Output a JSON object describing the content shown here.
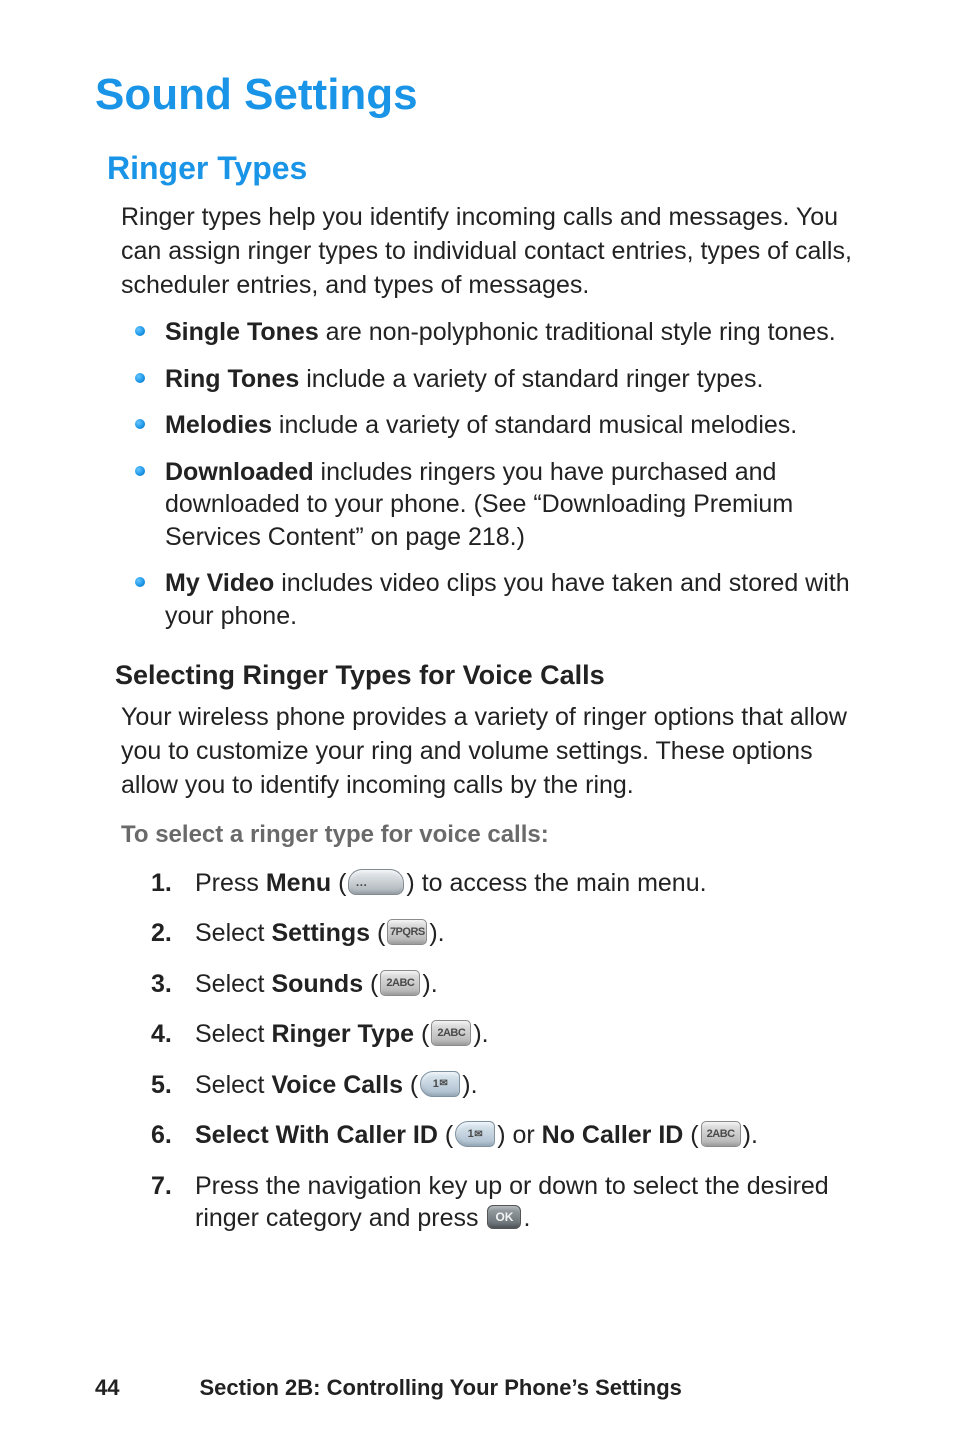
{
  "heading": "Sound Settings",
  "subheading": "Ringer Types",
  "intro": "Ringer types help you identify incoming calls and messages. You can assign ringer types to individual contact entries, types of calls, scheduler entries, and types of messages.",
  "bullets": [
    {
      "term": "Single Tones",
      "rest": " are non-polyphonic traditional style ring tones."
    },
    {
      "term": "Ring Tones",
      "rest": " include a variety of standard ringer types."
    },
    {
      "term": "Melodies",
      "rest": " include a variety of standard musical melodies."
    },
    {
      "term": "Downloaded",
      "rest": " includes ringers you have purchased and downloaded to your phone. (See “Downloading Premium Services Content” on page 218.)"
    },
    {
      "term": "My Video",
      "rest": " includes video clips you have taken and stored with your phone."
    }
  ],
  "subsection": "Selecting Ringer Types for Voice Calls",
  "subsection_para": "Your wireless phone provides a variety of ringer options that allow you to customize your ring and volume settings. These options allow you to identify incoming calls by the ring.",
  "instruction": "To select a ringer type for voice calls:",
  "steps": {
    "s1": {
      "prefix": "Press ",
      "bold": "Menu",
      "paren_open": " (",
      "paren_close": ") to access the main menu."
    },
    "s2": {
      "prefix": "Select ",
      "bold": "Settings",
      "paren_open": " (",
      "paren_close": ")."
    },
    "s3": {
      "prefix": "Select ",
      "bold": "Sounds",
      "paren_open": " (",
      "paren_close": ")."
    },
    "s4": {
      "prefix": "Select ",
      "bold": "Ringer Type",
      "paren_open": " (",
      "paren_close": ")."
    },
    "s5": {
      "prefix": "Select ",
      "bold": "Voice Calls",
      "paren_open": " (",
      "paren_close": ")."
    },
    "s6": {
      "bold1": "Select With Caller ID",
      "paren_open1": " (",
      "paren_close_or": ") or ",
      "bold2": "No Caller ID",
      "paren_open2": " (",
      "paren_close2": ")."
    },
    "s7": {
      "line1": "Press the navigation key up or down to select the desired ringer category and press ",
      "after": "."
    }
  },
  "keys": {
    "menu_glyph": "…",
    "k7": "7PQRS",
    "k2": "2ABC",
    "k1": "1",
    "mail": "✉",
    "ok": "OK"
  },
  "footer": {
    "page": "44",
    "section": "Section 2B: Controlling Your Phone’s Settings"
  }
}
